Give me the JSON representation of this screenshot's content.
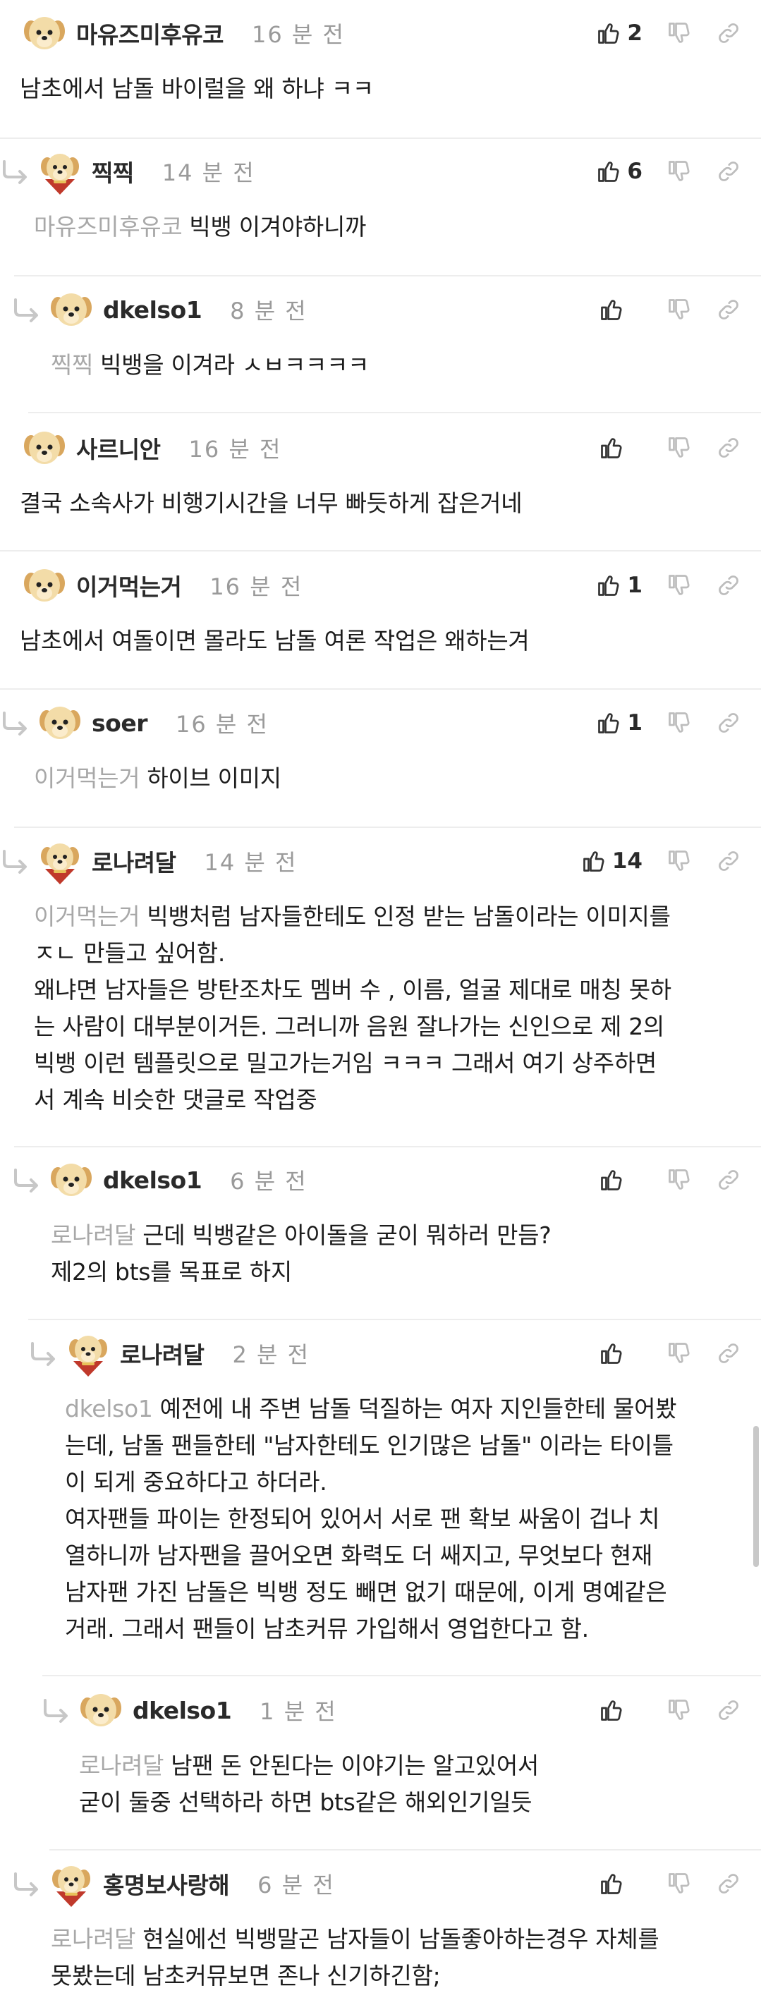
{
  "comments": [
    {
      "nick": "마유즈미후유코",
      "time": "16 분 전",
      "likes": "2",
      "text": "남초에서 남돌 바이럴을 왜 하냐 ㅋㅋ"
    },
    {
      "nick": "찍찍",
      "time": "14 분 전",
      "likes": "6",
      "mention": "마유즈미후유코",
      "text": "빅뱅 이겨야하니까"
    },
    {
      "nick": "dkelso1",
      "time": "8 분 전",
      "likes": "",
      "mention": "찍찍",
      "text": "빅뱅을 이겨라 ㅅㅂㅋㅋㅋㅋ"
    },
    {
      "nick": "사르니안",
      "time": "16 분 전",
      "likes": "",
      "text": "결국 소속사가 비행기시간을 너무 빠듯하게 잡은거네"
    },
    {
      "nick": "이거먹는거",
      "time": "16 분 전",
      "likes": "1",
      "text": "남초에서 여돌이면 몰라도 남돌 여론 작업은 왜하는겨"
    },
    {
      "nick": "soer",
      "time": "16 분 전",
      "likes": "1",
      "mention": "이거먹는거",
      "text": "하이브 이미지"
    },
    {
      "nick": "로나려달",
      "time": "14 분 전",
      "likes": "14",
      "mention": "이거먹는거",
      "lines": [
        "빅뱅처럼 남자들한테도 인정 받는 남돌이라는 이미지를",
        "ㅈㄴ 만들고 싶어함.",
        "왜냐면 남자들은 방탄조차도 멤버 수 , 이름, 얼굴 제대로 매칭 못하",
        "는 사람이 대부분이거든. 그러니까 음원 잘나가는 신인으로 제 2의",
        "빅뱅 이런 템플릿으로 밀고가는거임 ㅋㅋㅋ 그래서 여기 상주하면",
        "서 계속 비슷한 댓글로 작업중"
      ]
    },
    {
      "nick": "dkelso1",
      "time": "6 분 전",
      "likes": "",
      "mention": "로나려달",
      "lines": [
        "근데 빅뱅같은 아이돌을 굳이 뭐하러 만듬?",
        "제2의 bts를 목표로 하지"
      ]
    },
    {
      "nick": "로나려달",
      "time": "2 분 전",
      "likes": "",
      "mention": "dkelso1",
      "lines": [
        "예전에 내 주변 남돌 덕질하는 여자 지인들한테 물어봤",
        "는데, 남돌 팬들한테 \"남자한테도 인기많은 남돌\" 이라는 타이틀",
        "이 되게 중요하다고 하더라.",
        "여자팬들 파이는 한정되어 있어서 서로 팬 확보 싸움이 겁나 치",
        "열하니까 남자팬을 끌어오면 화력도 더 쌔지고, 무엇보다 현재",
        "남자팬 가진 남돌은 빅뱅 정도 빼면 없기 때문에, 이게 명예같은",
        "거래. 그래서 팬들이 남초커뮤 가입해서 영업한다고 함."
      ]
    },
    {
      "nick": "dkelso1",
      "time": "1 분 전",
      "likes": "",
      "mention": "로나려달",
      "lines": [
        "남팬 돈 안된다는 이야기는 알고있어서",
        "굳이 둘중 선택하라 하면 bts같은 해외인기일듯"
      ]
    },
    {
      "nick": "홍명보사랑해",
      "time": "6 분 전",
      "likes": "",
      "mention": "로나려달",
      "lines": [
        "현실에선 빅뱅말곤 남자들이 남돌좋아하는경우 자체를",
        "못봤는데 남초커뮤보면 존나 신기하긴함;"
      ]
    }
  ],
  "icons": {
    "like": "thumbs-up-icon",
    "dislike": "thumbs-down-icon",
    "link": "link-icon",
    "reply": "reply-arrow-icon",
    "avatar": "puppy-avatar"
  },
  "colors": {
    "mention": "#a8a8a8",
    "time": "#9a9a9a",
    "separator": "#ededed"
  }
}
